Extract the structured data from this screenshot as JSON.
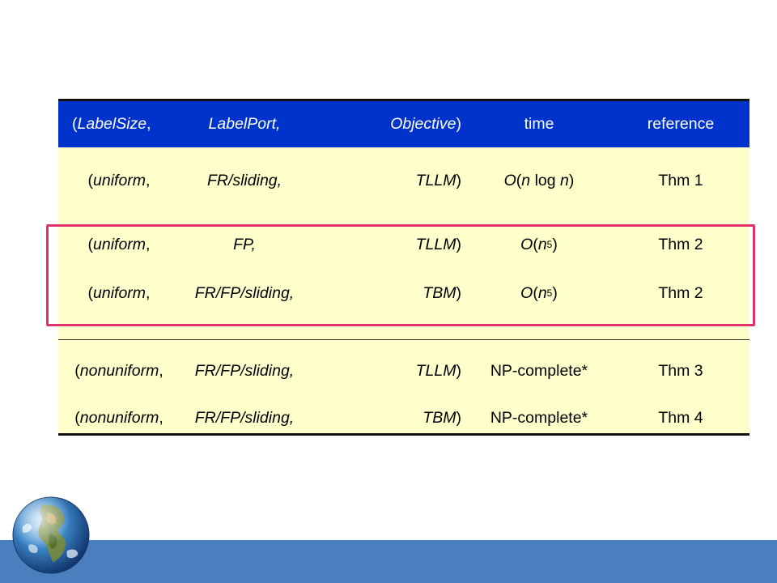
{
  "header": {
    "col1": "(LabelSize,",
    "col2": "LabelPort,",
    "col3": "Objective)",
    "col4": "time",
    "col5": "reference"
  },
  "rows": [
    {
      "c1": "(uniform,",
      "c2": "FR/sliding,",
      "c3": "TLLM)",
      "c4": "O(n log n)",
      "c5": "Thm 1"
    },
    {
      "c1": "(uniform,",
      "c2": "FP,",
      "c3": "TLLM)",
      "c4_base": "O(n",
      "c4_sup": "5",
      "c4_end": ")",
      "c5": "Thm 2"
    },
    {
      "c1": "(uniform,",
      "c2": "FR/FP/sliding,",
      "c3": "TBM)",
      "c4_base": "O(n",
      "c4_sup": "5",
      "c4_end": ")",
      "c5": "Thm 2"
    },
    {
      "c1": "(nonuniform,",
      "c2": "FR/FP/sliding,",
      "c3": "TLLM)",
      "c4": "NP-complete*",
      "c5": "Thm 3"
    },
    {
      "c1": "(nonuniform,",
      "c2": "FR/FP/sliding,",
      "c3": "TBM)",
      "c4": "NP-complete*",
      "c5": "Thm 4"
    }
  ],
  "colors": {
    "header_bg": "#0033CC",
    "row_bg": "#FFFFCC",
    "highlight": "#E0336E",
    "footer": "#4A7FBF"
  },
  "icons": {
    "logo": "globe-icon"
  }
}
